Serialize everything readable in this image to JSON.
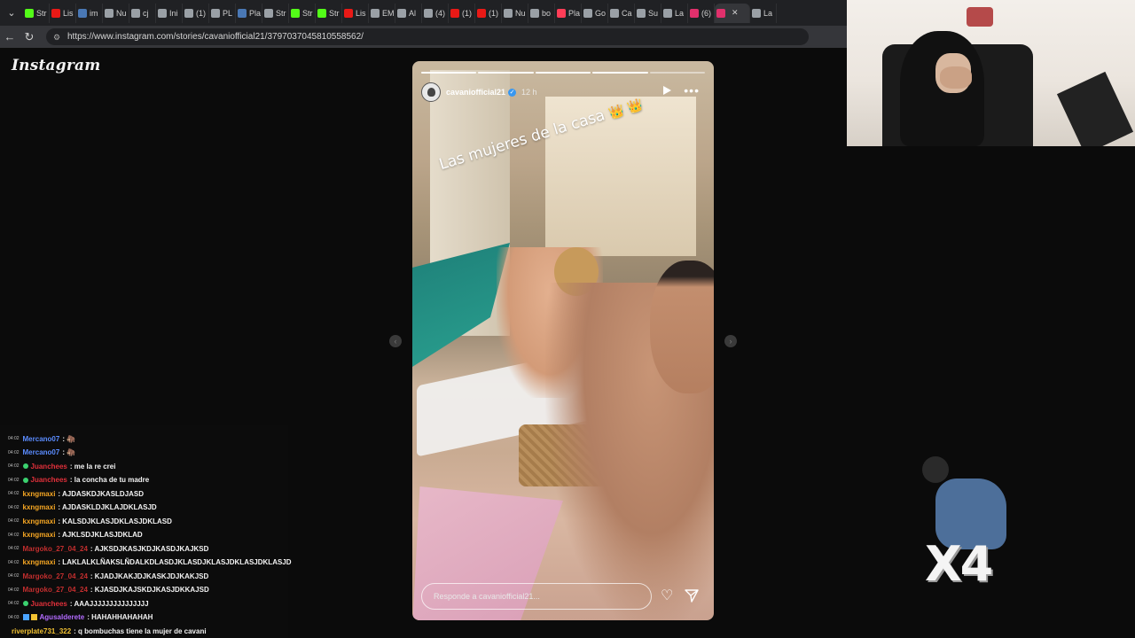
{
  "browser": {
    "tabs": [
      {
        "label": "Str",
        "icon": "kick-icon",
        "color": "#53fc18"
      },
      {
        "label": "Lis",
        "icon": "twitch-icon",
        "color": "#e91916"
      },
      {
        "label": "im",
        "icon": "doc-icon",
        "color": "#4a78b5"
      },
      {
        "label": "Nu",
        "icon": "page-icon",
        "color": "#9aa0a6"
      },
      {
        "label": "cj",
        "icon": "google-icon",
        "color": "#9aa0a6"
      },
      {
        "label": "Ini",
        "icon": "x-icon",
        "color": "#9aa0a6"
      },
      {
        "label": "(1)",
        "icon": "x-icon",
        "color": "#9aa0a6"
      },
      {
        "label": "PL",
        "icon": "slash-icon",
        "color": "#9aa0a6"
      },
      {
        "label": "Pla",
        "icon": "shield-icon",
        "color": "#4a78b5"
      },
      {
        "label": "Str",
        "icon": "x-icon",
        "color": "#9aa0a6"
      },
      {
        "label": "Str",
        "icon": "kick-icon",
        "color": "#53fc18"
      },
      {
        "label": "Str",
        "icon": "kick-icon",
        "color": "#53fc18"
      },
      {
        "label": "Lis",
        "icon": "twitch-icon",
        "color": "#e91916"
      },
      {
        "label": "EM",
        "icon": "circle-icon",
        "color": "#9aa0a6"
      },
      {
        "label": "Al",
        "icon": "slash-icon",
        "color": "#9aa0a6"
      },
      {
        "label": "(4)",
        "icon": "x-icon",
        "color": "#9aa0a6"
      },
      {
        "label": "(1)",
        "icon": "record-icon",
        "color": "#e91916"
      },
      {
        "label": "(1)",
        "icon": "record-icon",
        "color": "#e91916"
      },
      {
        "label": "Nu",
        "icon": "page-icon",
        "color": "#9aa0a6"
      },
      {
        "label": "bo",
        "icon": "x-icon",
        "color": "#9aa0a6"
      },
      {
        "label": "Pla",
        "icon": "play-icon",
        "color": "#ff3d57"
      },
      {
        "label": "Go",
        "icon": "google-icon",
        "color": "#9aa0a6"
      },
      {
        "label": "Ca",
        "icon": "pen-icon",
        "color": "#9aa0a6"
      },
      {
        "label": "Su",
        "icon": "sound-icon",
        "color": "#9aa0a6"
      },
      {
        "label": "La",
        "icon": "circle-icon",
        "color": "#9aa0a6"
      },
      {
        "label": "(6)",
        "icon": "instagram-icon",
        "color": "#e1306c"
      },
      {
        "label": "",
        "icon": "instagram-icon",
        "color": "#e1306c",
        "active": true
      },
      {
        "label": "La",
        "icon": "circle-icon",
        "color": "#9aa0a6"
      }
    ],
    "url": "https://www.instagram.com/stories/cavaniofficial21/3797037045810558562/"
  },
  "instagram": {
    "logo": "Instagram"
  },
  "story": {
    "username": "cavaniofficial21",
    "time": "12 h",
    "caption": "Las mujeres de la casa",
    "crowns": "👑 👑",
    "reply_placeholder": "Responde a cavaniofficial21...",
    "progress_total": 5,
    "progress_done": 4
  },
  "chat": [
    {
      "ts": "04:02",
      "user": "Mercano07",
      "color": "#5b8cff",
      "msg": ": 🦣",
      "badge": "none"
    },
    {
      "ts": "04:02",
      "user": "Mercano07",
      "color": "#5b8cff",
      "msg": ": 🦣",
      "badge": "none"
    },
    {
      "ts": "04:02",
      "user": "Juanchees",
      "color": "#e0303a",
      "msg": ": me la re crei",
      "badge": "green"
    },
    {
      "ts": "04:02",
      "user": "Juanchees",
      "color": "#e0303a",
      "msg": ": la concha de tu madre",
      "badge": "green"
    },
    {
      "ts": "04:02",
      "user": "kxngmaxi",
      "color": "#f5a623",
      "msg": ": AJDASKDJKASLDJASD",
      "badge": "none"
    },
    {
      "ts": "04:02",
      "user": "kxngmaxi",
      "color": "#f5a623",
      "msg": ": AJDASKLDJKLAJDKLASJD",
      "badge": "none"
    },
    {
      "ts": "04:02",
      "user": "kxngmaxi",
      "color": "#f5a623",
      "msg": ": KALSDJKLASJDKLASJDKLASD",
      "badge": "none"
    },
    {
      "ts": "04:02",
      "user": "kxngmaxi",
      "color": "#f5a623",
      "msg": ": AJKLSDJKLASJDKLAD",
      "badge": "none"
    },
    {
      "ts": "04:02",
      "user": "Margoko_27_04_24",
      "color": "#c22e2e",
      "msg": ": AJKSDJKASJKDJKASDJKAJKSD",
      "badge": "none"
    },
    {
      "ts": "04:02",
      "user": "kxngmaxi",
      "color": "#f5a623",
      "msg": ": LAKLALKLÑAKSLÑDALKDLASDJKLASDJKLASJDKLASJDKLASJD",
      "badge": "none"
    },
    {
      "ts": "04:02",
      "user": "Margoko_27_04_24",
      "color": "#c22e2e",
      "msg": ": KJADJKAKJDJKASKJDJKAKJSD",
      "badge": "none"
    },
    {
      "ts": "04:02",
      "user": "Margoko_27_04_24",
      "color": "#c22e2e",
      "msg": ": KJASDJKAJSKDJKASJDKKAJSD",
      "badge": "none"
    },
    {
      "ts": "04:02",
      "user": "Juanchees",
      "color": "#e0303a",
      "msg": ": AAAJJJJJJJJJJJJJJJ",
      "badge": "green"
    },
    {
      "ts": "04:03",
      "user": "Agusalderete",
      "color": "#b36bff",
      "msg": ": HAHAHHAHAHAH",
      "badge": "subs"
    },
    {
      "ts": "",
      "user": "riverplate731_322",
      "color": "#f2c232",
      "msg": ": q bombuchas tiene la mujer de cavani",
      "badge": "none"
    }
  ],
  "overlay": {
    "multiplier": "X4"
  }
}
